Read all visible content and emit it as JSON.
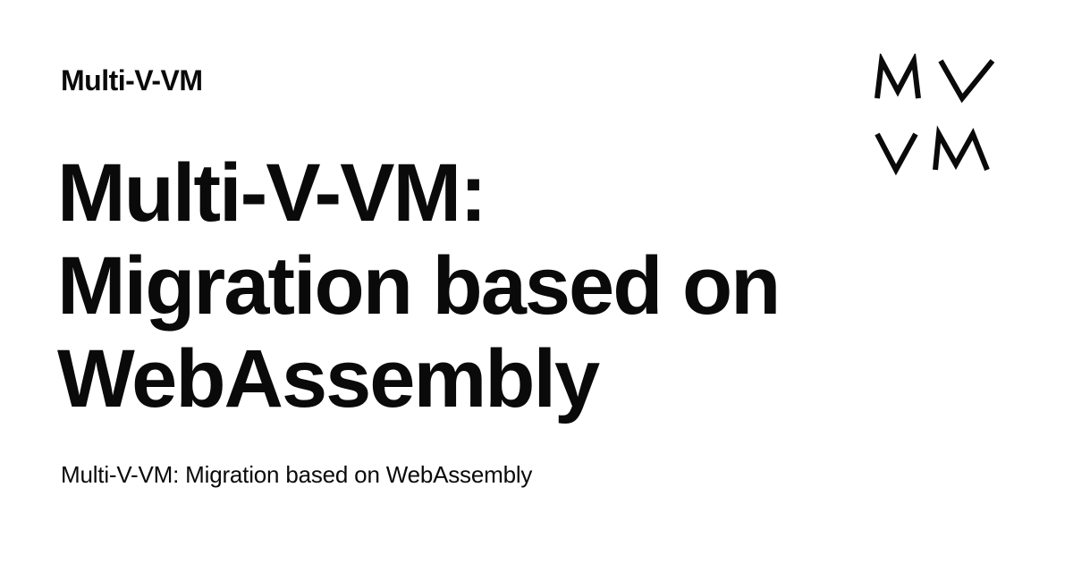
{
  "site": {
    "name": "Multi-V-VM"
  },
  "title": {
    "lines": [
      "Multi-V-VM:",
      "Migration based on",
      "WebAssembly"
    ]
  },
  "description": "Multi-V-VM: Migration based on WebAssembly",
  "logo": {
    "icon": "mv-vm-logo",
    "text_row1": "MV",
    "text_row2": "VM",
    "color": "#0a0a0a"
  },
  "colors": {
    "background": "#ffffff",
    "text": "#0a0a0a"
  }
}
